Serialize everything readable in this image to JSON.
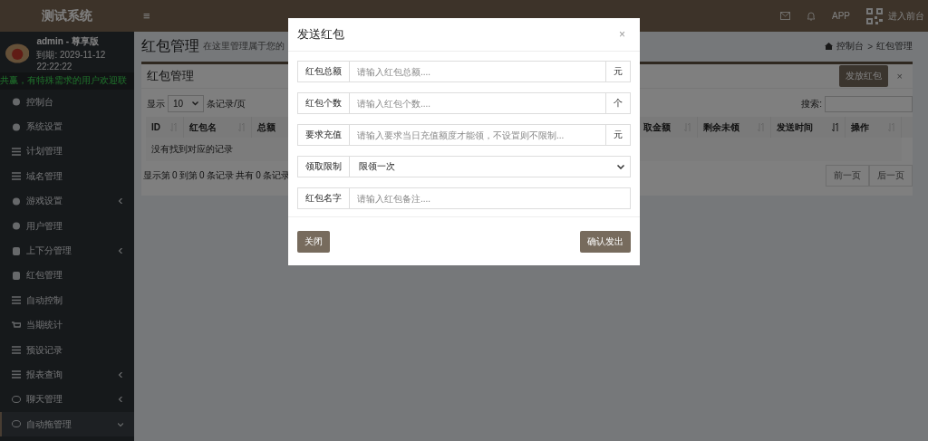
{
  "topbar": {
    "logo": "测试系统",
    "menu_toggle": "≡",
    "app_label": "APP",
    "front_link": "进入前台"
  },
  "user": {
    "name": "admin - 尊享版",
    "expiry": "到期: 2029-11-12 22:22:22",
    "notice": "共赢，有特殊需求的用户欢迎联"
  },
  "sidebar": {
    "items": [
      {
        "label": "控制台",
        "kind": "link",
        "expanded": false,
        "selected": false
      },
      {
        "label": "系统设置",
        "kind": "link",
        "expanded": false,
        "selected": false
      },
      {
        "label": "计划管理",
        "kind": "link",
        "expanded": false,
        "selected": false
      },
      {
        "label": "域名管理",
        "kind": "link",
        "expanded": false,
        "selected": false
      },
      {
        "label": "游戏设置",
        "kind": "submenu",
        "expanded": false,
        "selected": false
      },
      {
        "label": "用户管理",
        "kind": "link",
        "expanded": false,
        "selected": false
      },
      {
        "label": "上下分管理",
        "kind": "submenu",
        "expanded": false,
        "selected": false
      },
      {
        "label": "红包管理",
        "kind": "link",
        "expanded": false,
        "selected": false
      },
      {
        "label": "自动控制",
        "kind": "link",
        "expanded": false,
        "selected": false
      },
      {
        "label": "当期统计",
        "kind": "link",
        "expanded": false,
        "selected": false
      },
      {
        "label": "预设记录",
        "kind": "link",
        "expanded": false,
        "selected": false
      },
      {
        "label": "报表查询",
        "kind": "submenu",
        "expanded": false,
        "selected": false
      },
      {
        "label": "聊天管理",
        "kind": "submenu",
        "expanded": false,
        "selected": false
      },
      {
        "label": "自动拖管理",
        "kind": "submenu",
        "expanded": true,
        "selected": true
      }
    ]
  },
  "page_header": {
    "title": "红包管理",
    "subtitle": "在这里管理属于您的",
    "breadcrumb": [
      "控制台",
      "红包管理"
    ],
    "breadcrumb_separator": ">"
  },
  "panel": {
    "title": "红包管理",
    "send_button": "发放红包",
    "close": "×",
    "length_label_before": "显示",
    "page_size": "10",
    "length_label_after": "条记录/页",
    "search_label": "搜索:",
    "table": {
      "columns": [
        {
          "label": "ID",
          "sorted": false
        },
        {
          "label": "红包名",
          "sorted": false
        },
        {
          "label": "总额"
        },
        {
          "label": "取金额",
          "sorted": false
        },
        {
          "label": "剩余未领",
          "sorted": false
        },
        {
          "label": "发送时间",
          "sorted": true
        },
        {
          "label": "操作",
          "sorted": false
        }
      ],
      "empty_text": "没有找到对应的记录"
    },
    "info": "显示第 0 到第 0 条记录 共有 0 条记录",
    "pager": [
      "前一页",
      "后一页"
    ]
  },
  "modal": {
    "title": "发送红包",
    "close": "×",
    "fields": [
      {
        "kind": "input",
        "label": "红包总额",
        "placeholder": "请输入红包总额....",
        "suffix": "元"
      },
      {
        "kind": "input",
        "label": "红包个数",
        "placeholder": "请输入红包个数....",
        "suffix": "个"
      },
      {
        "kind": "input",
        "label": "要求充值",
        "placeholder": "请输入要求当日充值额度才能领，不设置则不限制...",
        "suffix": "元"
      },
      {
        "kind": "select",
        "label": "领取限制",
        "value": "限领一次"
      },
      {
        "kind": "input",
        "label": "红包名字",
        "placeholder": "请输入红包备注...."
      }
    ],
    "close_button": "关闭",
    "confirm_button": "确认发出"
  }
}
